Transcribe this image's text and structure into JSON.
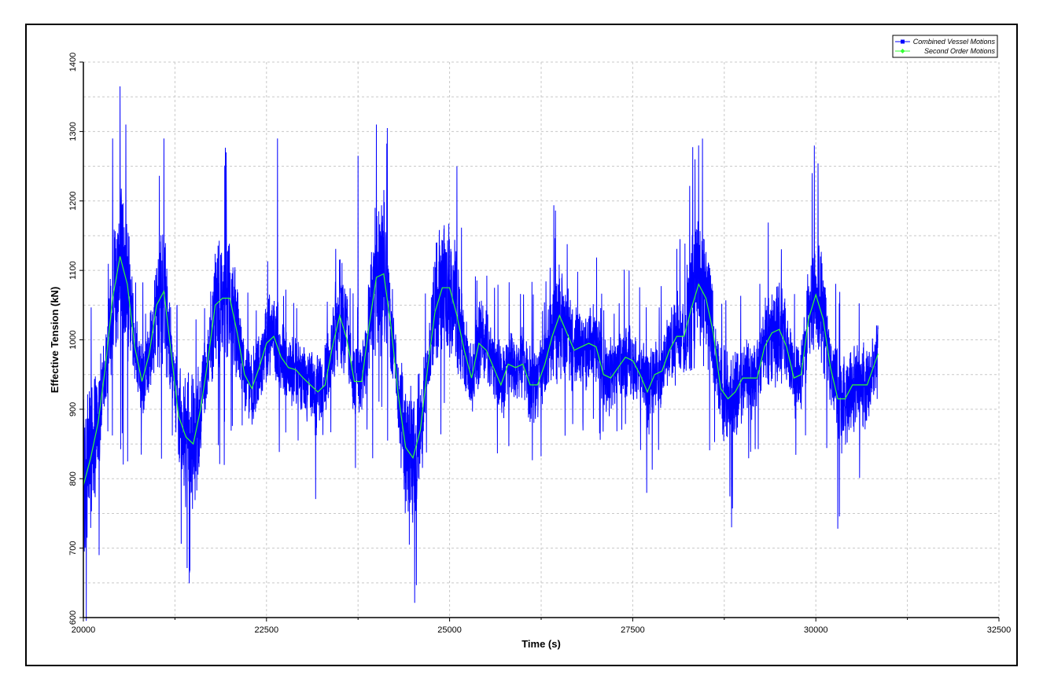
{
  "chart_data": {
    "type": "line",
    "title": "",
    "xlabel": "Time (s)",
    "ylabel": "Effective Tension (kN)",
    "xlim": [
      20000,
      32500
    ],
    "ylim": [
      600,
      1400
    ],
    "x_ticks": [
      20000,
      22500,
      25000,
      27500,
      30000,
      32500
    ],
    "y_ticks": [
      600,
      700,
      800,
      900,
      1000,
      1100,
      1200,
      1300,
      1400
    ],
    "grid": true,
    "legend_position": "top-right",
    "x_end": 30850,
    "series": [
      {
        "name": "Combined Vessel Motions",
        "color": "#0000ff",
        "marker": "square",
        "style": "high-frequency oscillation about the slow-drift curve",
        "peak_max": {
          "x": 20500,
          "y": 1365
        },
        "trough_min": {
          "x": 21450,
          "y": 665
        },
        "notable_peaks": [
          {
            "x": 20400,
            "y": 1290
          },
          {
            "x": 20580,
            "y": 1310
          },
          {
            "x": 21100,
            "y": 1290
          },
          {
            "x": 21950,
            "y": 1270
          },
          {
            "x": 22650,
            "y": 1290
          },
          {
            "x": 23750,
            "y": 1265
          },
          {
            "x": 24000,
            "y": 1310
          },
          {
            "x": 24150,
            "y": 1305
          },
          {
            "x": 25100,
            "y": 1250
          },
          {
            "x": 28350,
            "y": 1260
          },
          {
            "x": 28400,
            "y": 1280
          },
          {
            "x": 29950,
            "y": 1240
          }
        ],
        "notable_troughs": [
          {
            "x": 20050,
            "y": 715
          },
          {
            "x": 21450,
            "y": 665
          },
          {
            "x": 24450,
            "y": 705
          },
          {
            "x": 28850,
            "y": 730
          },
          {
            "x": 30300,
            "y": 728
          }
        ]
      },
      {
        "name": "Second Order Motions",
        "color": "#33ff33",
        "marker": "diamond",
        "x": [
          20000,
          20100,
          20200,
          20300,
          20400,
          20500,
          20600,
          20700,
          20800,
          20900,
          21000,
          21100,
          21200,
          21300,
          21400,
          21500,
          21600,
          21700,
          21800,
          21900,
          22000,
          22100,
          22200,
          22300,
          22400,
          22500,
          22600,
          22700,
          22800,
          22900,
          23000,
          23100,
          23200,
          23300,
          23400,
          23500,
          23600,
          23700,
          23800,
          23900,
          24000,
          24100,
          24200,
          24300,
          24400,
          24500,
          24600,
          24700,
          24800,
          24900,
          25000,
          25100,
          25200,
          25300,
          25400,
          25500,
          25600,
          25700,
          25800,
          25900,
          26000,
          26100,
          26200,
          26300,
          26400,
          26500,
          26600,
          26700,
          26800,
          26900,
          27000,
          27100,
          27200,
          27300,
          27400,
          27500,
          27600,
          27700,
          27800,
          27900,
          28000,
          28100,
          28200,
          28300,
          28400,
          28500,
          28600,
          28700,
          28800,
          28900,
          29000,
          29100,
          29200,
          29300,
          29400,
          29500,
          29600,
          29700,
          29800,
          29900,
          30000,
          30100,
          30200,
          30300,
          30400,
          30500,
          30600,
          30700,
          30850
        ],
        "y": [
          790,
          830,
          880,
          960,
          1060,
          1120,
          1080,
          990,
          940,
          980,
          1050,
          1070,
          980,
          890,
          860,
          850,
          900,
          970,
          1050,
          1060,
          1060,
          1010,
          950,
          930,
          960,
          995,
          1005,
          975,
          960,
          957,
          945,
          935,
          925,
          935,
          990,
          1035,
          1000,
          940,
          940,
          1020,
          1090,
          1095,
          1020,
          920,
          845,
          830,
          870,
          960,
          1040,
          1075,
          1075,
          1035,
          985,
          945,
          995,
          985,
          960,
          935,
          965,
          960,
          965,
          935,
          935,
          965,
          1005,
          1035,
          1010,
          985,
          990,
          995,
          990,
          950,
          945,
          960,
          975,
          970,
          950,
          925,
          950,
          955,
          985,
          1005,
          1005,
          1045,
          1080,
          1060,
          1010,
          930,
          915,
          925,
          945,
          945,
          945,
          990,
          1010,
          1015,
          990,
          945,
          950,
          1030,
          1065,
          1030,
          960,
          915,
          915,
          935,
          935,
          935,
          980
        ]
      }
    ]
  }
}
